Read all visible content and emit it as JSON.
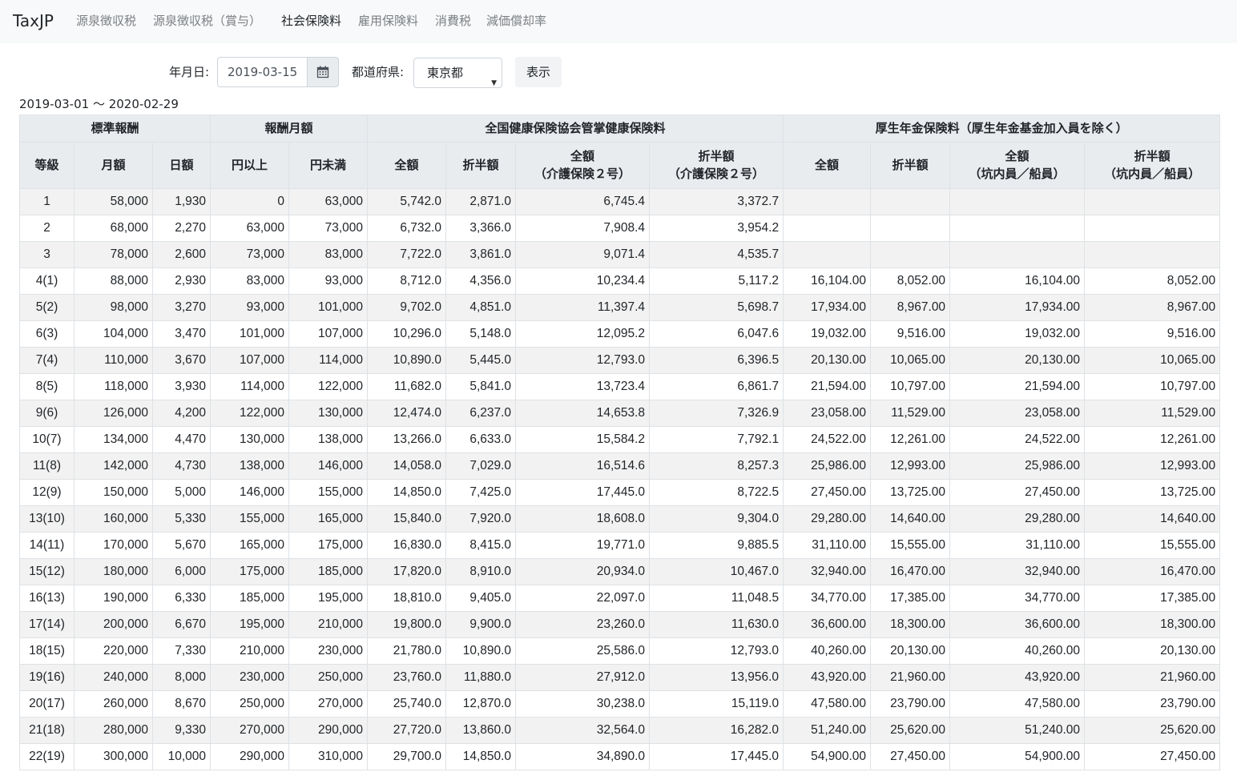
{
  "app": {
    "brand": "TaxJP"
  },
  "nav": [
    {
      "label": "源泉徴収税",
      "active": false
    },
    {
      "label": "源泉徴収税（賞与）",
      "active": false
    },
    {
      "label": "社会保険料",
      "active": true
    },
    {
      "label": "雇用保険料",
      "active": false
    },
    {
      "label": "消費税",
      "active": false
    },
    {
      "label": "減価償却率",
      "active": false
    }
  ],
  "form": {
    "date_label": "年月日:",
    "date_value": "2019-03-15",
    "pref_label": "都道府県:",
    "pref_value": "東京都",
    "submit_label": "表示",
    "icon": "calendar-icon"
  },
  "period": "2019-03-01 〜 2020-02-29",
  "table": {
    "group_headers": [
      {
        "label": "標準報酬",
        "colspan": 3
      },
      {
        "label": "報酬月額",
        "colspan": 2
      },
      {
        "label": "全国健康保険協会管掌健康保険料",
        "colspan": 4
      },
      {
        "label": "厚生年金保険料（厚生年金基金加入員を除く）",
        "colspan": 4
      }
    ],
    "columns": [
      [
        "等級"
      ],
      [
        "月額"
      ],
      [
        "日額"
      ],
      [
        "円以上"
      ],
      [
        "円未満"
      ],
      [
        "全額"
      ],
      [
        "折半額"
      ],
      [
        "全額",
        "（介護保険２号）"
      ],
      [
        "折半額",
        "（介護保険２号）"
      ],
      [
        "全額"
      ],
      [
        "折半額"
      ],
      [
        "全額",
        "（坑内員／船員）"
      ],
      [
        "折半額",
        "（坑内員／船員）"
      ]
    ],
    "rows": [
      [
        "1",
        "58,000",
        "1,930",
        "0",
        "63,000",
        "5,742.0",
        "2,871.0",
        "6,745.4",
        "3,372.7",
        "",
        "",
        "",
        ""
      ],
      [
        "2",
        "68,000",
        "2,270",
        "63,000",
        "73,000",
        "6,732.0",
        "3,366.0",
        "7,908.4",
        "3,954.2",
        "",
        "",
        "",
        ""
      ],
      [
        "3",
        "78,000",
        "2,600",
        "73,000",
        "83,000",
        "7,722.0",
        "3,861.0",
        "9,071.4",
        "4,535.7",
        "",
        "",
        "",
        ""
      ],
      [
        "4(1)",
        "88,000",
        "2,930",
        "83,000",
        "93,000",
        "8,712.0",
        "4,356.0",
        "10,234.4",
        "5,117.2",
        "16,104.00",
        "8,052.00",
        "16,104.00",
        "8,052.00"
      ],
      [
        "5(2)",
        "98,000",
        "3,270",
        "93,000",
        "101,000",
        "9,702.0",
        "4,851.0",
        "11,397.4",
        "5,698.7",
        "17,934.00",
        "8,967.00",
        "17,934.00",
        "8,967.00"
      ],
      [
        "6(3)",
        "104,000",
        "3,470",
        "101,000",
        "107,000",
        "10,296.0",
        "5,148.0",
        "12,095.2",
        "6,047.6",
        "19,032.00",
        "9,516.00",
        "19,032.00",
        "9,516.00"
      ],
      [
        "7(4)",
        "110,000",
        "3,670",
        "107,000",
        "114,000",
        "10,890.0",
        "5,445.0",
        "12,793.0",
        "6,396.5",
        "20,130.00",
        "10,065.00",
        "20,130.00",
        "10,065.00"
      ],
      [
        "8(5)",
        "118,000",
        "3,930",
        "114,000",
        "122,000",
        "11,682.0",
        "5,841.0",
        "13,723.4",
        "6,861.7",
        "21,594.00",
        "10,797.00",
        "21,594.00",
        "10,797.00"
      ],
      [
        "9(6)",
        "126,000",
        "4,200",
        "122,000",
        "130,000",
        "12,474.0",
        "6,237.0",
        "14,653.8",
        "7,326.9",
        "23,058.00",
        "11,529.00",
        "23,058.00",
        "11,529.00"
      ],
      [
        "10(7)",
        "134,000",
        "4,470",
        "130,000",
        "138,000",
        "13,266.0",
        "6,633.0",
        "15,584.2",
        "7,792.1",
        "24,522.00",
        "12,261.00",
        "24,522.00",
        "12,261.00"
      ],
      [
        "11(8)",
        "142,000",
        "4,730",
        "138,000",
        "146,000",
        "14,058.0",
        "7,029.0",
        "16,514.6",
        "8,257.3",
        "25,986.00",
        "12,993.00",
        "25,986.00",
        "12,993.00"
      ],
      [
        "12(9)",
        "150,000",
        "5,000",
        "146,000",
        "155,000",
        "14,850.0",
        "7,425.0",
        "17,445.0",
        "8,722.5",
        "27,450.00",
        "13,725.00",
        "27,450.00",
        "13,725.00"
      ],
      [
        "13(10)",
        "160,000",
        "5,330",
        "155,000",
        "165,000",
        "15,840.0",
        "7,920.0",
        "18,608.0",
        "9,304.0",
        "29,280.00",
        "14,640.00",
        "29,280.00",
        "14,640.00"
      ],
      [
        "14(11)",
        "170,000",
        "5,670",
        "165,000",
        "175,000",
        "16,830.0",
        "8,415.0",
        "19,771.0",
        "9,885.5",
        "31,110.00",
        "15,555.00",
        "31,110.00",
        "15,555.00"
      ],
      [
        "15(12)",
        "180,000",
        "6,000",
        "175,000",
        "185,000",
        "17,820.0",
        "8,910.0",
        "20,934.0",
        "10,467.0",
        "32,940.00",
        "16,470.00",
        "32,940.00",
        "16,470.00"
      ],
      [
        "16(13)",
        "190,000",
        "6,330",
        "185,000",
        "195,000",
        "18,810.0",
        "9,405.0",
        "22,097.0",
        "11,048.5",
        "34,770.00",
        "17,385.00",
        "34,770.00",
        "17,385.00"
      ],
      [
        "17(14)",
        "200,000",
        "6,670",
        "195,000",
        "210,000",
        "19,800.0",
        "9,900.0",
        "23,260.0",
        "11,630.0",
        "36,600.00",
        "18,300.00",
        "36,600.00",
        "18,300.00"
      ],
      [
        "18(15)",
        "220,000",
        "7,330",
        "210,000",
        "230,000",
        "21,780.0",
        "10,890.0",
        "25,586.0",
        "12,793.0",
        "40,260.00",
        "20,130.00",
        "40,260.00",
        "20,130.00"
      ],
      [
        "19(16)",
        "240,000",
        "8,000",
        "230,000",
        "250,000",
        "23,760.0",
        "11,880.0",
        "27,912.0",
        "13,956.0",
        "43,920.00",
        "21,960.00",
        "43,920.00",
        "21,960.00"
      ],
      [
        "20(17)",
        "260,000",
        "8,670",
        "250,000",
        "270,000",
        "25,740.0",
        "12,870.0",
        "30,238.0",
        "15,119.0",
        "47,580.00",
        "23,790.00",
        "47,580.00",
        "23,790.00"
      ],
      [
        "21(18)",
        "280,000",
        "9,330",
        "270,000",
        "290,000",
        "27,720.0",
        "13,860.0",
        "32,564.0",
        "16,282.0",
        "51,240.00",
        "25,620.00",
        "51,240.00",
        "25,620.00"
      ],
      [
        "22(19)",
        "300,000",
        "10,000",
        "290,000",
        "310,000",
        "29,700.0",
        "14,850.0",
        "34,890.0",
        "17,445.0",
        "54,900.00",
        "27,450.00",
        "54,900.00",
        "27,450.00"
      ]
    ]
  }
}
